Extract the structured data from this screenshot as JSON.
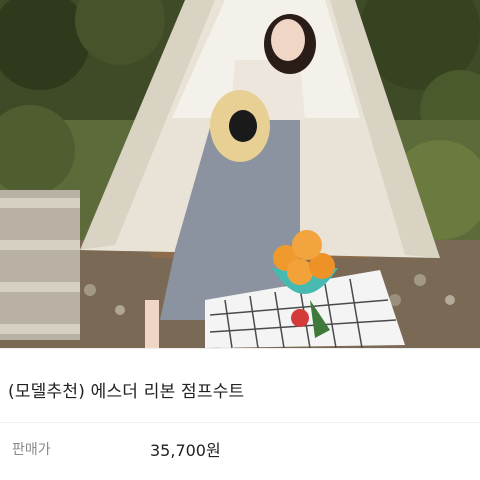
{
  "product": {
    "name": "(모델추천) 에스더 리본 점프수트",
    "price_label": "판매가",
    "price_value": "35,700원"
  }
}
